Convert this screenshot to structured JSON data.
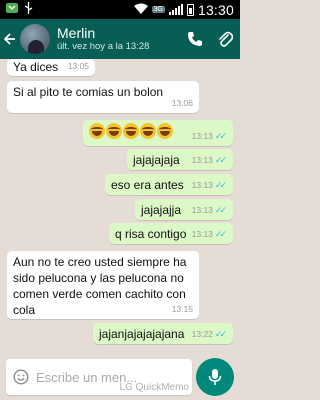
{
  "status_bar": {
    "network": "3G",
    "time": "13:30"
  },
  "header": {
    "back_icon": "arrow-left",
    "contact_name": "Merlin",
    "last_seen": "últ. vez hoy a la 13:28",
    "call_icon": "phone-icon",
    "attach_icon": "paperclip-icon"
  },
  "messages": [
    {
      "dir": "in",
      "text": "Ya dices",
      "time": "13:05"
    },
    {
      "dir": "in",
      "text": "Si al pito te comias un bolon",
      "time": "13:06"
    },
    {
      "dir": "out",
      "text": "",
      "emoji_count": 5,
      "emoji": "tears-of-joy",
      "time": "13:13",
      "read": true
    },
    {
      "dir": "out",
      "text": "jajajajaja",
      "time": "13:13",
      "read": true
    },
    {
      "dir": "out",
      "text": "eso era antes",
      "time": "13:13",
      "read": true
    },
    {
      "dir": "out",
      "text": "jajajajja",
      "time": "13:13",
      "read": true
    },
    {
      "dir": "out",
      "text": "q risa contigo",
      "time": "13:13",
      "read": true
    },
    {
      "dir": "in",
      "text": "Aun no te creo usted siempre ha sido pelucona y las pelucona no comen verde comen cachito con cola",
      "time": "13:15"
    },
    {
      "dir": "out",
      "text": "jajanjajajajajana",
      "time": "13:22",
      "read": true
    }
  ],
  "composer": {
    "placeholder": "Escribe un men...",
    "watermark": "LG QuickMemo",
    "emoji_icon": "smiley-icon",
    "mic_icon": "microphone-icon"
  },
  "colors": {
    "header": "#075e54",
    "outgoing": "#dcf8c6",
    "incoming": "#ffffff",
    "read_ticks": "#34b7f1",
    "mic": "#00897b"
  }
}
